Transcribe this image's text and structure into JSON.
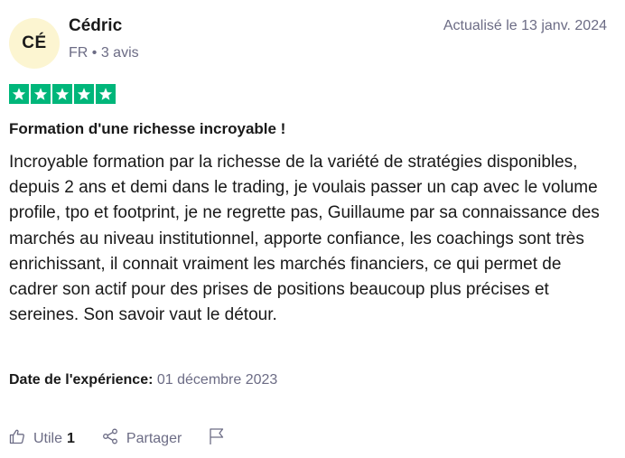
{
  "reviewer": {
    "initials": "CÉ",
    "name": "Cédric",
    "meta": "FR • 3 avis"
  },
  "updated": "Actualisé le 13 janv. 2024",
  "rating": {
    "value": 5,
    "max": 5,
    "color": "#00b67a"
  },
  "review": {
    "title": "Formation d'une richesse incroyable !",
    "body": "Incroyable formation par la richesse de la variété de stratégies disponibles, depuis 2 ans et demi dans le trading, je voulais passer un cap avec le volume profile, tpo et footprint, je ne regrette pas, Guillaume par sa connaissance des marchés au niveau institutionnel, apporte confiance, les coachings sont très enrichissant, il connait vraiment les marchés financiers, ce qui permet de cadrer son actif pour des prises de positions beaucoup plus précises et sereines. Son savoir vaut le détour."
  },
  "experience": {
    "label": "Date de l'expérience:",
    "date": "01 décembre 2023"
  },
  "actions": {
    "useful_label": "Utile",
    "useful_count": "1",
    "share_label": "Partager",
    "icons": [
      "thumbs-up-icon",
      "share-icon",
      "flag-icon"
    ]
  }
}
